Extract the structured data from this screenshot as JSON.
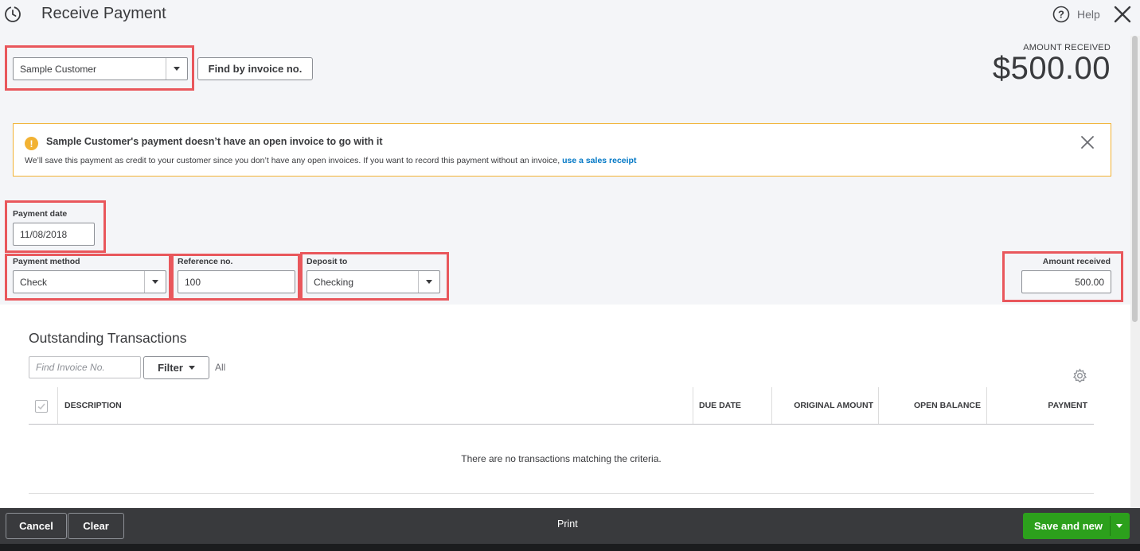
{
  "header": {
    "title": "Receive Payment",
    "help_label": "Help"
  },
  "customer": {
    "selected": "Sample Customer",
    "find_invoice_label": "Find by invoice no."
  },
  "amount": {
    "label": "AMOUNT RECEIVED",
    "value": "$500.00"
  },
  "alert": {
    "title": "Sample Customer's payment doesn’t have an open invoice to go with it",
    "text": "We’ll save this payment as credit to your customer since you don’t have any open invoices. If you want to record this payment without an invoice, ",
    "link": "use a sales receipt"
  },
  "form": {
    "payment_date_label": "Payment date",
    "payment_date_value": "11/08/2018",
    "payment_method_label": "Payment method",
    "payment_method_value": "Check",
    "reference_label": "Reference no.",
    "reference_value": "100",
    "deposit_label": "Deposit to",
    "deposit_value": "Checking",
    "amount_received_label": "Amount received",
    "amount_received_value": "500.00"
  },
  "transactions": {
    "title": "Outstanding Transactions",
    "search_placeholder": "Find Invoice No.",
    "filter_label": "Filter",
    "filter_value": "All",
    "columns": [
      "DESCRIPTION",
      "DUE DATE",
      "ORIGINAL AMOUNT",
      "OPEN BALANCE",
      "PAYMENT"
    ],
    "empty_message": "There are no transactions matching the criteria."
  },
  "footer": {
    "cancel_label": "Cancel",
    "clear_label": "Clear",
    "print_label": "Print",
    "save_new_label": "Save and new"
  },
  "colors": {
    "highlight_box": "#e9575c",
    "primary_green": "#2ca01c",
    "link_blue": "#0077c5",
    "warning": "#f2b233"
  }
}
